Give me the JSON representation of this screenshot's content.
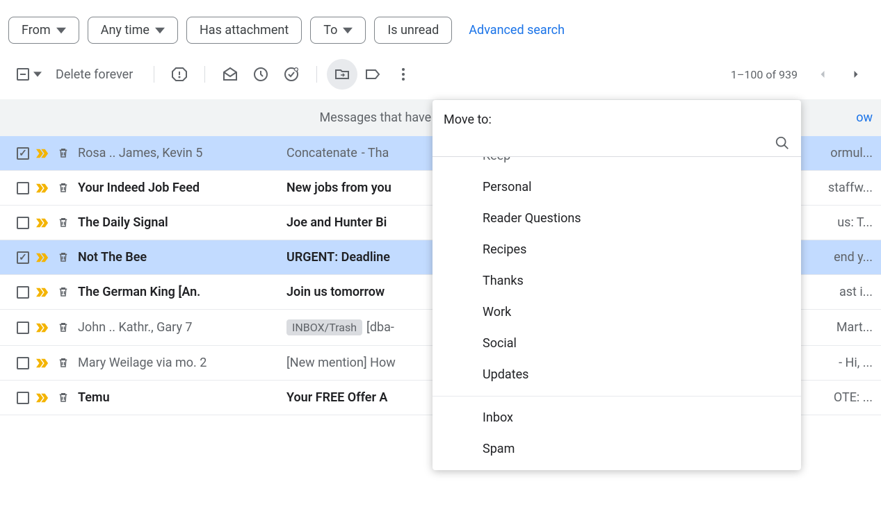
{
  "filters": {
    "from": "From",
    "anytime": "Any time",
    "attachment": "Has attachment",
    "to": "To",
    "unread": "Is unread",
    "advanced": "Advanced search"
  },
  "toolbar": {
    "delete_forever": "Delete forever",
    "page_info": "1–100 of 939"
  },
  "banner": {
    "text": "Messages that have been in Trash more tha",
    "empty_now": "ow"
  },
  "dropdown": {
    "title": "Move to:",
    "search_placeholder": "",
    "items_top": [
      "Keep"
    ],
    "items": [
      "Personal",
      "Reader Questions",
      "Recipes",
      "Thanks",
      "Work",
      "Social",
      "Updates"
    ],
    "items_system": [
      "Inbox",
      "Spam"
    ]
  },
  "rows": [
    {
      "selected": true,
      "read": true,
      "important": true,
      "sender": "Rosa .. James, Kevin",
      "count": "5",
      "label": "",
      "subject": "Concatenate",
      "snippet": " - Tha",
      "trail": "ormul..."
    },
    {
      "selected": false,
      "read": false,
      "important": true,
      "sender": "Your Indeed Job Feed",
      "count": "",
      "label": "",
      "subject": "New jobs from you",
      "snippet": "",
      "trail": "staffw..."
    },
    {
      "selected": false,
      "read": false,
      "important": true,
      "sender": "The Daily Signal",
      "count": "",
      "label": "",
      "subject": "Joe and Hunter Bi",
      "snippet": "",
      "trail": "us: T..."
    },
    {
      "selected": true,
      "read": false,
      "important": true,
      "sender": "Not The Bee",
      "count": "",
      "label": "",
      "subject": "URGENT: Deadline",
      "snippet": "",
      "trail": "end y..."
    },
    {
      "selected": false,
      "read": false,
      "important": true,
      "sender": "The German King [An.",
      "count": "",
      "label": "",
      "subject": "Join us tomorrow",
      "snippet": "",
      "trail": "ast i..."
    },
    {
      "selected": false,
      "read": true,
      "important": true,
      "sender": "John .. Kathr., Gary",
      "count": "7",
      "label": "INBOX/Trash",
      "subject": "[dba-",
      "snippet": "",
      "trail": "Mart..."
    },
    {
      "selected": false,
      "read": true,
      "important": true,
      "sender": "Mary Weilage via mo.",
      "count": "2",
      "label": "",
      "subject": "[New mention] How",
      "snippet": "",
      "trail": " - Hi, ..."
    },
    {
      "selected": false,
      "read": false,
      "important": true,
      "sender": "Temu",
      "count": "",
      "label": "",
      "subject": "Your FREE Offer A",
      "snippet": "",
      "trail": "OTE: ..."
    }
  ]
}
